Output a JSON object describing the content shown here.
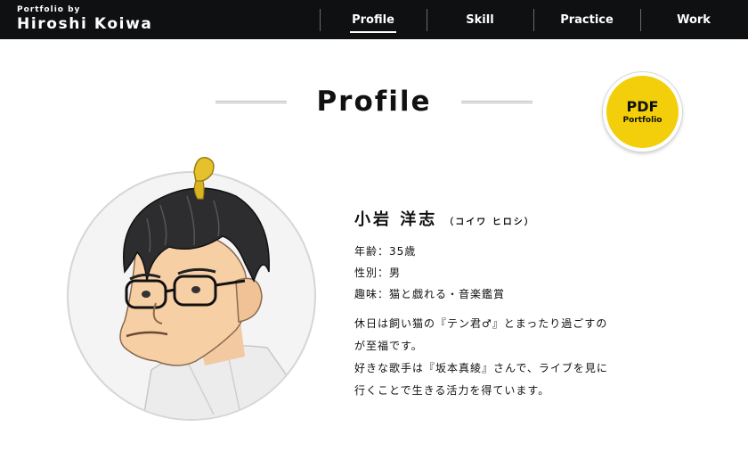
{
  "header": {
    "brand_sub": "Portfolio by",
    "brand_name": "Hiroshi Koiwa",
    "nav": [
      {
        "label": "Profile",
        "active": true
      },
      {
        "label": "Skill",
        "active": false
      },
      {
        "label": "Practice",
        "active": false
      },
      {
        "label": "Work",
        "active": false
      }
    ]
  },
  "section": {
    "title": "Profile"
  },
  "pdf_badge": {
    "title": "PDF",
    "subtitle": "Portfolio",
    "color": "#f2cf0a"
  },
  "avatar": {
    "icon": "portrait-illustration"
  },
  "profile": {
    "name": "小岩 洋志",
    "kana": "（コイワ ヒロシ）",
    "facts": [
      "年齢：35歳",
      "性別：男",
      "趣味：猫と戯れる・音楽鑑賞"
    ],
    "bio": [
      "休日は飼い猫の『テン君♂』とまったり過ごすの",
      "が至福です。",
      "好きな歌手は『坂本真綾』さんで、ライブを見に",
      "行くことで生きる活力を得ています。"
    ]
  },
  "colors": {
    "header_bg": "#0f1012",
    "accent_yellow": "#f2cf0a",
    "text": "#111111"
  }
}
